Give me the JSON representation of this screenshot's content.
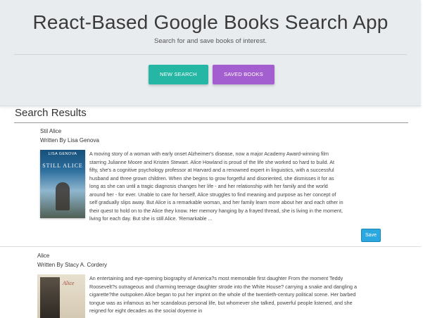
{
  "header": {
    "title": "React-Based Google Books Search App",
    "subtitle": "Search for and save books of interest.",
    "new_search_label": "NEW SEARCH",
    "saved_books_label": "SAVED BOOKS"
  },
  "results": {
    "heading": "Search Results",
    "save_label": "Save",
    "books": [
      {
        "title": "Stil Alice",
        "author": "Written By Lisa Genova",
        "cover_author": "LISA GENOVA",
        "cover_title": "STILL ALICE",
        "description": "A moving story of a woman with early onset Alzheimer's disease, now a major Academy Award-winning film starring Julianne Moore and Kristen Stewart. Alice Howland is proud of the life she worked so hard to build. At fifty, she's a cognitive psychology professor at Harvard and a renowned expert in linguistics, with a successful husband and three grown children. When she begins to grow forgetful and disoriented, she dismisses it for as long as she can until a tragic diagnosis changes her life - and her relationship with her family and the world around her - for ever. Unable to care for herself, Alice struggles to find meaning and purpose as her concept of self gradually slips away. But Alice is a remarkable woman, and her family learn more about her and each other in their quest to hold on to the Alice they know. Her memory hanging by a frayed thread, she is living in the moment, living for each day. But she is still Alice. 'Remarkable ..."
      },
      {
        "title": "Alice",
        "author": "Written By Stacy A. Cordery",
        "cover_title": "Alice",
        "description": "An entertaining and eye-opening biography of America?s most memorable first daughter From the moment Teddy Roosevelt?s outrageous and charming teenage daughter strode into the White House? carrying a snake and dangling a cigarette?the outspoken Alice began to put her imprint on the whole of the twentieth-century political scene. Her barbed tongue was as infamous as her scandalous personal life, but whomever she talked, powerful people listened, and she reigned for eight decades as the social doyenne in"
      }
    ]
  },
  "colors": {
    "new_search_button": "#26b6a4",
    "saved_books_button": "#a35fd0",
    "save_button": "#2ba8e0",
    "header_background": "#e9ecef"
  }
}
